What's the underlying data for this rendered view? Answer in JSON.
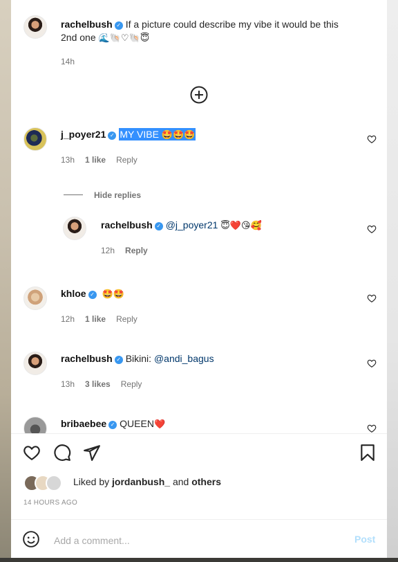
{
  "caption": {
    "username": "rachelbush",
    "text_line1": "If a picture could describe my vibe it would be this",
    "text_line2": "2nd one",
    "emojis": "🌊🐚♡🐚😇",
    "time": "14h"
  },
  "comments": [
    {
      "username": "j_poyer21",
      "text": "MY VIBE",
      "emojis": "🤩🤩🤩",
      "time": "13h",
      "likes": "1 like",
      "reply": "Reply",
      "hide_replies": "Hide replies"
    },
    {
      "username": "rachelbush",
      "mention": "@j_poyer21",
      "emojis": "😇❤️😘🥰",
      "time": "12h",
      "reply": "Reply"
    },
    {
      "username": "khloe",
      "emojis": "🤩🤩",
      "time": "12h",
      "likes": "1 like",
      "reply": "Reply"
    },
    {
      "username": "rachelbush",
      "text": "Bikini:",
      "mention": "@andi_bagus",
      "time": "13h",
      "likes": "3 likes",
      "reply": "Reply"
    },
    {
      "username": "bribaebee",
      "text": "QUEEN",
      "emojis": "❤️"
    }
  ],
  "actions": {
    "like_icon": "heart-icon",
    "comment_icon": "comment-icon",
    "share_icon": "send-icon",
    "save_icon": "bookmark-icon"
  },
  "likes": {
    "prefix": "Liked by",
    "user": "jordanbush_",
    "joiner": "and",
    "others": "others"
  },
  "post_time": "14 HOURS AGO",
  "comment_box": {
    "placeholder": "Add a comment...",
    "post_label": "Post"
  },
  "colors": {
    "verified": "#3897f0",
    "mention": "#00376b",
    "highlight": "#3390ff",
    "post_disabled": "#b2dffc",
    "secondary_text": "#737373"
  }
}
